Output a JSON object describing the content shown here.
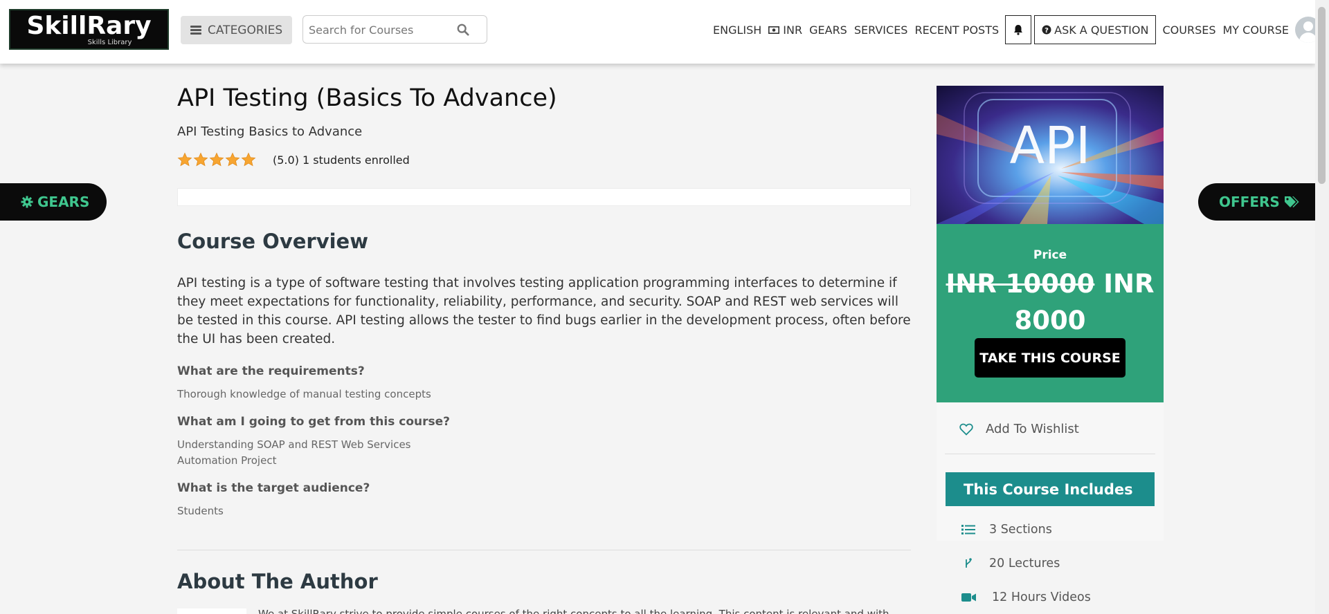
{
  "header": {
    "logo_main": "SkillRary",
    "logo_sub": "Skills Library",
    "categories_label": "CATEGORIES",
    "search_placeholder": "Search for Courses",
    "nav": {
      "english": "ENGLISH",
      "currency": "INR",
      "gears": "GEARS",
      "services": "SERVICES",
      "recent_posts": "RECENT POSTS",
      "ask": "ASK A QUESTION",
      "courses": "COURSES",
      "my_course": "MY COURSE"
    }
  },
  "side_tabs": {
    "gears": "GEARS",
    "offers": "OFFERS"
  },
  "course": {
    "title": "API Testing (Basics To Advance)",
    "subtitle": "API Testing Basics to Advance",
    "rating_stars": 5,
    "rating_text": "(5.0) 1 students enrolled",
    "overview_heading": "Course Overview",
    "overview": "API testing is a type of software testing that involves testing application programming interfaces to determine if they meet expectations for functionality, reliability, performance, and security. SOAP and REST web services will be tested in this course. API testing allows the tester to find bugs earlier in the development process, often before the UI has been created.",
    "q1": "What are the requirements?",
    "a1": "Thorough knowledge of manual testing concepts",
    "q2": "What am I going to get from this course?",
    "a2_1": "Understanding SOAP and REST Web Services",
    "a2_2": "Automation Project",
    "q3": "What is the target audience?",
    "a3": "Students",
    "author_heading": "About The Author",
    "author_text": "We at SkillRary strive to provide simple courses of the right concepts to all the learning. This content is relevant and with"
  },
  "sidebar": {
    "image_text": "API",
    "price_label": "Price",
    "old_price": "INR 10000",
    "new_price_a": "INR",
    "new_price_b": "8000",
    "take_course": "TAKE THIS COURSE",
    "wishlist": "Add To Wishlist",
    "includes_heading": "This Course Includes",
    "sections": "3 Sections",
    "lectures": "20 Lectures",
    "videos": "12 Hours Videos"
  },
  "colors": {
    "accent_green": "#2fa27a",
    "teal": "#1c8d8c",
    "tab_text": "#3fc68e"
  }
}
